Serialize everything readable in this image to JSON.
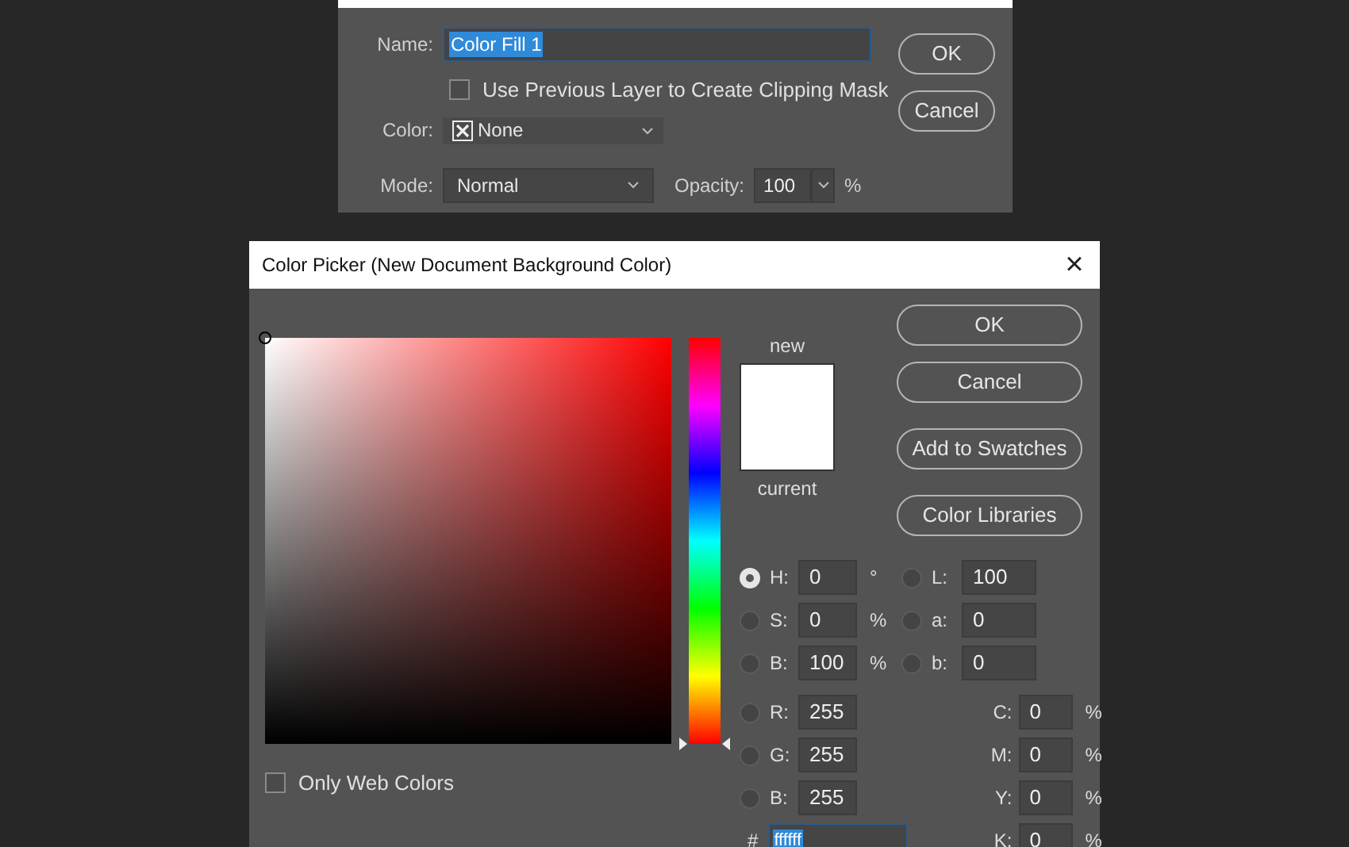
{
  "fill_dialog": {
    "name_label": "Name:",
    "name_value": "Color Fill 1",
    "clipping_checkbox": {
      "label": "Use Previous Layer to Create Clipping Mask",
      "checked": false
    },
    "color_label": "Color:",
    "color_value": "None",
    "mode_label": "Mode:",
    "mode_value": "Normal",
    "opacity_label": "Opacity:",
    "opacity_value": "100",
    "opacity_unit": "%",
    "buttons": [
      "OK",
      "Cancel"
    ]
  },
  "color_picker": {
    "title": "Color Picker (New Document Background Color)",
    "close": "×",
    "new_label": "new",
    "current_label": "current",
    "hue_slider": {
      "level": 0
    },
    "buttons": [
      "OK",
      "Cancel",
      "Add to Swatches",
      "Color Libraries"
    ],
    "hsb_fields": [
      {
        "label": "H:",
        "value": "0",
        "unit": "°",
        "selected": true
      },
      {
        "label": "S:",
        "value": "0",
        "unit": "%",
        "selected": false
      },
      {
        "label": "B:",
        "value": "100",
        "unit": "%",
        "selected": false
      }
    ],
    "lab_fields": [
      {
        "label": "L:",
        "value": "100",
        "selected": false
      },
      {
        "label": "a:",
        "value": "0",
        "selected": false
      },
      {
        "label": "b:",
        "value": "0",
        "selected": false
      }
    ],
    "rgb_fields": [
      {
        "label": "R:",
        "value": "255",
        "selected": false
      },
      {
        "label": "G:",
        "value": "255",
        "selected": false
      },
      {
        "label": "B:",
        "value": "255",
        "selected": false
      }
    ],
    "cmyk_fields": [
      {
        "label": "C:",
        "value": "0",
        "unit": "%"
      },
      {
        "label": "M:",
        "value": "0",
        "unit": "%"
      },
      {
        "label": "Y:",
        "value": "0",
        "unit": "%"
      },
      {
        "label": "K:",
        "value": "0",
        "unit": "%"
      }
    ],
    "hex_label": "#",
    "hex_value": "ffffff",
    "web_colors_checkbox": {
      "label": "Only Web Colors",
      "checked": false
    }
  }
}
